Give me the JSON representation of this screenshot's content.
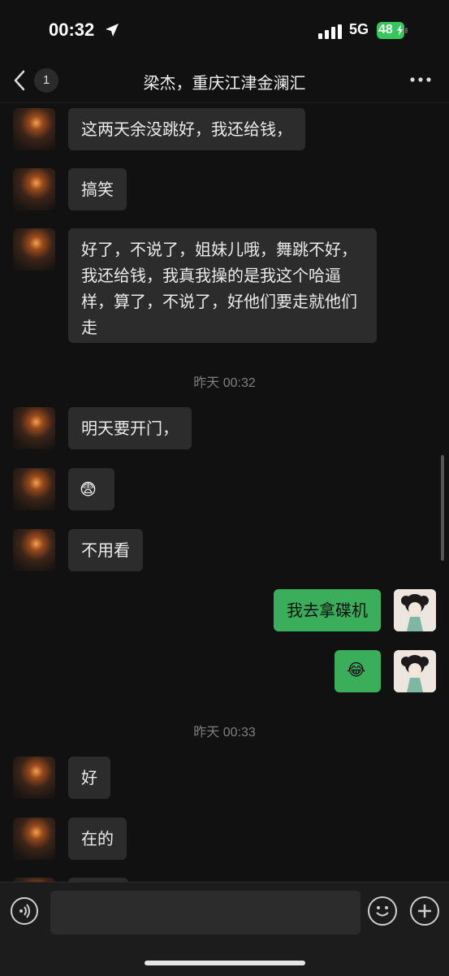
{
  "status": {
    "time": "00:32",
    "network": "5G",
    "battery": "48"
  },
  "nav": {
    "back_count": "1",
    "title": "梁杰，重庆江津金澜汇"
  },
  "messages": [
    {
      "side": "left",
      "text": "这两天余没跳好，我还给钱，"
    },
    {
      "side": "left",
      "text": "搞笑"
    },
    {
      "side": "left",
      "text": "好了，不说了，姐妹儿哦，舞跳不好，我还给钱，我真我操的是我这个哈逼样，算了，不说了，好他们要走就他们走"
    },
    {
      "side": "left",
      "text": "明天要开门，"
    },
    {
      "side": "left",
      "emoji": "😨"
    },
    {
      "side": "left",
      "text": "不用看"
    },
    {
      "side": "right",
      "text": "我去拿碟机"
    },
    {
      "side": "right",
      "emoji": "😂"
    },
    {
      "side": "left",
      "text": "好"
    },
    {
      "side": "left",
      "text": "在的"
    }
  ],
  "timestamps": [
    "昨天 00:32",
    "昨天 00:33"
  ],
  "icons": {
    "location": "location-arrow-icon",
    "signal": "signal-bars-icon",
    "battery": "battery-icon",
    "back": "chevron-left-icon",
    "more": "more-dots-icon",
    "voice": "voice-icon",
    "emoji": "emoji-icon",
    "plus": "plus-icon"
  },
  "colors": {
    "background": "#111111",
    "bubble_left": "#2c2c2c",
    "bubble_right": "#3aae5a",
    "battery": "#34c759"
  }
}
